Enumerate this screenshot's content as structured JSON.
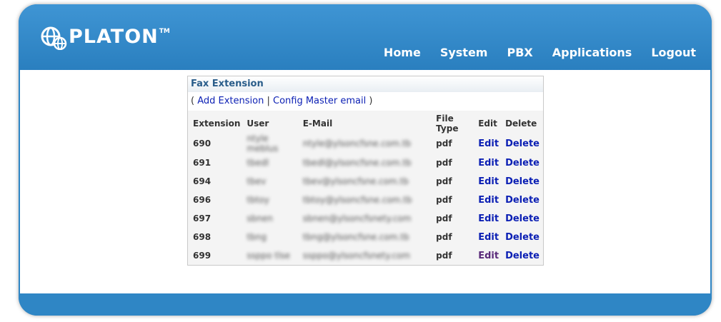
{
  "brand": {
    "name": "PLATON",
    "trademark": "TM"
  },
  "nav": [
    "Home",
    "System",
    "PBX",
    "Applications",
    "Logout"
  ],
  "panel": {
    "title": "Fax Extension",
    "open_paren": "( ",
    "add_extension": "Add Extension",
    "separator": " | ",
    "config_master": "Config Master email",
    "close_paren": " )"
  },
  "table": {
    "headers": [
      "Extension",
      "User",
      "E-Mail",
      "File Type",
      "Edit",
      "Delete"
    ],
    "rows": [
      {
        "ext": "690",
        "user": "ntyle meblus",
        "email": "ntyle@ylsoncfsne.com.tb",
        "type": "pdf",
        "edit": "Edit",
        "delete": "Delete"
      },
      {
        "ext": "691",
        "user": "tbedl",
        "email": "tbedl@ylsoncfsne.com.tb",
        "type": "pdf",
        "edit": "Edit",
        "delete": "Delete"
      },
      {
        "ext": "694",
        "user": "tbev",
        "email": "tbev@ylsoncfsne.com.tb",
        "type": "pdf",
        "edit": "Edit",
        "delete": "Delete"
      },
      {
        "ext": "696",
        "user": "tbtoy",
        "email": "tbtoy@ylsoncfsne.com.tb",
        "type": "pdf",
        "edit": "Edit",
        "delete": "Delete"
      },
      {
        "ext": "697",
        "user": "sbnen",
        "email": "sbnen@ylsoncfsnety.com",
        "type": "pdf",
        "edit": "Edit",
        "delete": "Delete"
      },
      {
        "ext": "698",
        "user": "tbng",
        "email": "tbng@ylsoncfsne.com.tb",
        "type": "pdf",
        "edit": "Edit",
        "delete": "Delete"
      },
      {
        "ext": "699",
        "user": "ssppo tlse",
        "email": "ssppo@ylsoncfsnety.com",
        "type": "pdf",
        "edit": "Edit",
        "delete": "Delete"
      }
    ]
  },
  "colors": {
    "brand_blue": "#2f86c5",
    "link": "#0b1fb4",
    "title": "#2a5d8a"
  },
  "icons": {
    "logo": "globe-icon"
  }
}
